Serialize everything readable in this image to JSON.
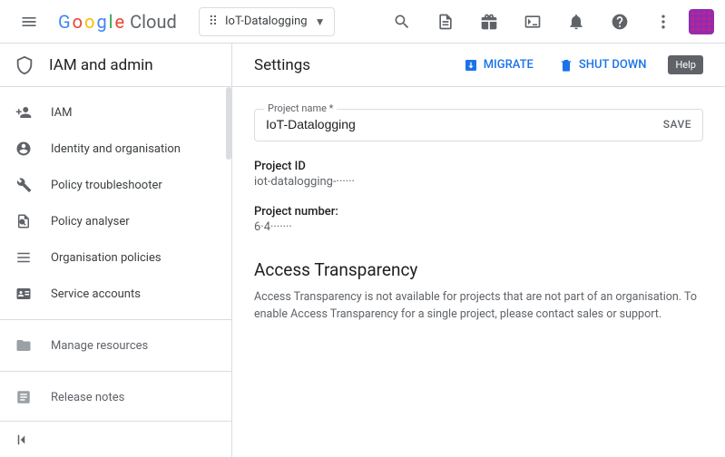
{
  "topbar": {
    "logo_text": "Google",
    "logo_cloud": "Cloud",
    "project_name": "IoT-Datalogging"
  },
  "sidebar": {
    "title": "IAM and admin",
    "items": [
      {
        "label": "IAM",
        "icon": "person-add"
      },
      {
        "label": "Identity and organisation",
        "icon": "person-circle"
      },
      {
        "label": "Policy troubleshooter",
        "icon": "wrench"
      },
      {
        "label": "Policy analyser",
        "icon": "doc-search"
      },
      {
        "label": "Organisation policies",
        "icon": "list"
      },
      {
        "label": "Service accounts",
        "icon": "badge"
      }
    ],
    "secondary": [
      {
        "label": "Manage resources",
        "icon": "folder"
      },
      {
        "label": "Release notes",
        "icon": "notes"
      }
    ]
  },
  "content": {
    "title": "Settings",
    "migrate": "MIGRATE",
    "shutdown": "SHUT DOWN",
    "help": "Help",
    "project_name_label": "Project name *",
    "project_name_value": "IoT-Datalogging",
    "save": "SAVE",
    "project_id_label": "Project ID",
    "project_id_value": "iot-datalogging-······",
    "project_number_label": "Project number:",
    "project_number_value": "6·4·······",
    "access_title": "Access Transparency",
    "access_body": "Access Transparency is not available for projects that are not part of an organisation. To enable Access Transparency for a single project, please contact sales or support."
  }
}
